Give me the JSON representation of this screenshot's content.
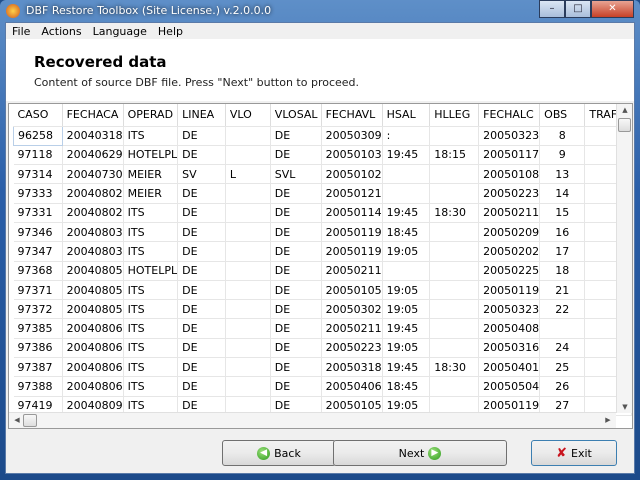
{
  "window": {
    "title": "DBF Restore Toolbox (Site License.) v.2.0.0.0",
    "minimize": "–",
    "maximize": "□",
    "close": "✕"
  },
  "menu": [
    "File",
    "Actions",
    "Language",
    "Help"
  ],
  "header": {
    "title": "Recovered data",
    "subtitle": "Content of source DBF file. Press \"Next\" button to proceed."
  },
  "table": {
    "columns": [
      "CASO",
      "FECHACA",
      "OPERAD",
      "LINEA",
      "VLO",
      "VLOSAL",
      "FECHAVL",
      "HSAL",
      "HLLEG",
      "FECHALC",
      "OBS",
      "TRAF"
    ],
    "rows": [
      [
        "96258",
        "20040318",
        "ITS",
        "DE",
        "",
        "DE",
        "20050309",
        ":",
        "",
        "20050323",
        "8",
        ""
      ],
      [
        "97118",
        "20040629",
        "HOTELPL",
        "DE",
        "",
        "DE",
        "20050103",
        "19:45",
        "18:15",
        "20050117",
        "9",
        ""
      ],
      [
        "97314",
        "20040730",
        "MEIER",
        "SV",
        "L",
        "SVL",
        "20050102",
        "",
        "",
        "20050108",
        "13",
        ""
      ],
      [
        "97333",
        "20040802",
        "MEIER",
        "DE",
        "",
        "DE",
        "20050121",
        "",
        "",
        "20050223",
        "14",
        ""
      ],
      [
        "97331",
        "20040802",
        "ITS",
        "DE",
        "",
        "DE",
        "20050114",
        "19:45",
        "18:30",
        "20050211",
        "15",
        ""
      ],
      [
        "97346",
        "20040803",
        "ITS",
        "DE",
        "",
        "DE",
        "20050119",
        "18:45",
        "",
        "20050209",
        "16",
        ""
      ],
      [
        "97347",
        "20040803",
        "ITS",
        "DE",
        "",
        "DE",
        "20050119",
        "19:05",
        "",
        "20050202",
        "17",
        ""
      ],
      [
        "97368",
        "20040805",
        "HOTELPL",
        "DE",
        "",
        "DE",
        "20050211",
        "",
        "",
        "20050225",
        "18",
        ""
      ],
      [
        "97371",
        "20040805",
        "ITS",
        "DE",
        "",
        "DE",
        "20050105",
        "19:05",
        "",
        "20050119",
        "21",
        ""
      ],
      [
        "97372",
        "20040805",
        "ITS",
        "DE",
        "",
        "DE",
        "20050302",
        "19:05",
        "",
        "20050323",
        "22",
        ""
      ],
      [
        "97385",
        "20040806",
        "ITS",
        "DE",
        "",
        "DE",
        "20050211",
        "19:45",
        "",
        "20050408",
        "",
        ""
      ],
      [
        "97386",
        "20040806",
        "ITS",
        "DE",
        "",
        "DE",
        "20050223",
        "19:05",
        "",
        "20050316",
        "24",
        ""
      ],
      [
        "97387",
        "20040806",
        "ITS",
        "DE",
        "",
        "DE",
        "20050318",
        "19:45",
        "18:30",
        "20050401",
        "25",
        ""
      ],
      [
        "97388",
        "20040806",
        "ITS",
        "DE",
        "",
        "DE",
        "20050406",
        "18:45",
        "",
        "20050504",
        "26",
        ""
      ],
      [
        "97419",
        "20040809",
        "ITS",
        "DE",
        "",
        "DE",
        "20050105",
        "19:05",
        "",
        "20050119",
        "27",
        ""
      ]
    ]
  },
  "buttons": {
    "back": "Back",
    "next": "Next",
    "exit": "Exit"
  }
}
